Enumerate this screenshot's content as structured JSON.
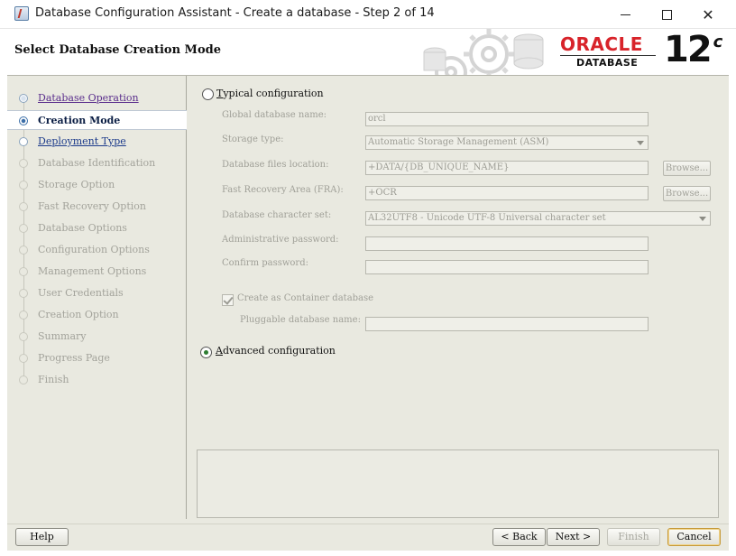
{
  "window": {
    "title": "Database Configuration Assistant - Create a database - Step 2 of 14",
    "controls": {
      "minimize": "minimize-icon",
      "maximize": "maximize-icon",
      "close": "✕"
    }
  },
  "header": {
    "heading": "Select Database Creation Mode",
    "logo": {
      "brand": "ORACLE",
      "registered": "®",
      "product": "DATABASE",
      "version": "12",
      "version_suffix": "c"
    },
    "brand_color": "#d8232a"
  },
  "sidebar": {
    "items": [
      {
        "label": "Database Operation",
        "state": "done"
      },
      {
        "label": "Creation Mode",
        "state": "current"
      },
      {
        "label": "Deployment Type",
        "state": "next"
      },
      {
        "label": "Database Identification",
        "state": "pending"
      },
      {
        "label": "Storage Option",
        "state": "pending"
      },
      {
        "label": "Fast Recovery Option",
        "state": "pending"
      },
      {
        "label": "Database Options",
        "state": "pending"
      },
      {
        "label": "Configuration Options",
        "state": "pending"
      },
      {
        "label": "Management Options",
        "state": "pending"
      },
      {
        "label": "User Credentials",
        "state": "pending"
      },
      {
        "label": "Creation Option",
        "state": "pending"
      },
      {
        "label": "Summary",
        "state": "pending"
      },
      {
        "label": "Progress Page",
        "state": "pending"
      },
      {
        "label": "Finish",
        "state": "pending"
      }
    ]
  },
  "form": {
    "typical": {
      "mnemonic": "T",
      "rest": "ypical configuration",
      "selected": false
    },
    "fields": {
      "global_db_name": {
        "label": "Global database name:",
        "value": "orcl"
      },
      "storage_type": {
        "label": "Storage type:",
        "value": "Automatic Storage Management (ASM)"
      },
      "db_files_location": {
        "label": "Database files location:",
        "value": "+DATA/{DB_UNIQUE_NAME}",
        "browse": "Browse..."
      },
      "fra": {
        "label": "Fast Recovery Area (FRA):",
        "value": "+OCR",
        "browse": "Browse..."
      },
      "charset": {
        "label": "Database character set:",
        "value": "AL32UTF8 - Unicode UTF-8 Universal character set"
      },
      "admin_password": {
        "label": "Administrative password:",
        "value": ""
      },
      "confirm_password": {
        "label": "Confirm password:",
        "value": ""
      },
      "container": {
        "label": "Create as Container database",
        "checked": true
      },
      "pdb_name": {
        "label": "Pluggable database name:",
        "value": ""
      }
    },
    "advanced": {
      "mnemonic": "A",
      "rest": "dvanced configuration",
      "selected": true
    }
  },
  "footer": {
    "help": "Help",
    "back": "< Back",
    "next": "Next >",
    "finish": "Finish",
    "cancel": "Cancel"
  }
}
